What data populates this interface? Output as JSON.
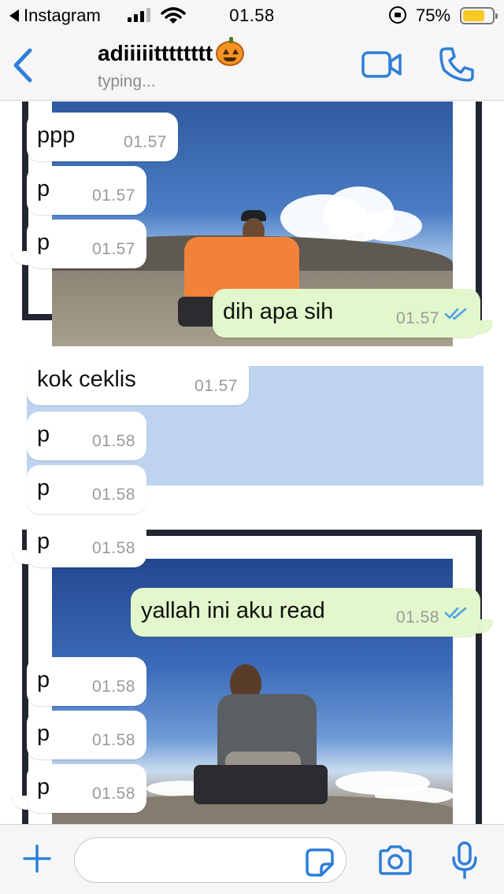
{
  "status_bar": {
    "back_app": "Instagram",
    "time": "01.58",
    "battery": "75%",
    "battery_level": 0.75
  },
  "header": {
    "contact_name": "adiiiiitttttttt",
    "contact_status": "typing..."
  },
  "messages": [
    {
      "dir": "in",
      "text": "ppp",
      "time": "01.57"
    },
    {
      "dir": "in",
      "text": "p",
      "time": "01.57"
    },
    {
      "dir": "in",
      "text": "p",
      "time": "01.57"
    },
    {
      "dir": "out",
      "text": "dih apa sih",
      "time": "01.57"
    },
    {
      "dir": "in",
      "text": "kok ceklis",
      "time": "01.57"
    },
    {
      "dir": "in",
      "text": "p",
      "time": "01.58"
    },
    {
      "dir": "in",
      "text": "p",
      "time": "01.58"
    },
    {
      "dir": "in",
      "text": "p",
      "time": "01.58"
    },
    {
      "dir": "out",
      "text": "yallah ini aku read",
      "time": "01.58"
    },
    {
      "dir": "in",
      "text": "p",
      "time": "01.58"
    },
    {
      "dir": "in",
      "text": "p",
      "time": "01.58"
    },
    {
      "dir": "in",
      "text": "p",
      "time": "01.58"
    }
  ],
  "input_bar": {
    "message_placeholder": ""
  },
  "colors": {
    "accent": "#2f7fd8",
    "outgoing_bubble": "#e2f7cb",
    "incoming_bubble": "#ffffff",
    "read_ticks": "#4fa4e8",
    "blue_panel": "#bed3ef",
    "frame": "#21262f"
  },
  "icons": [
    "back-chevron-icon",
    "video-call-icon",
    "phone-icon",
    "plus-icon",
    "sticker-icon",
    "camera-icon",
    "microphone-icon",
    "read-receipt-icon",
    "pumpkin-emoji-icon"
  ]
}
